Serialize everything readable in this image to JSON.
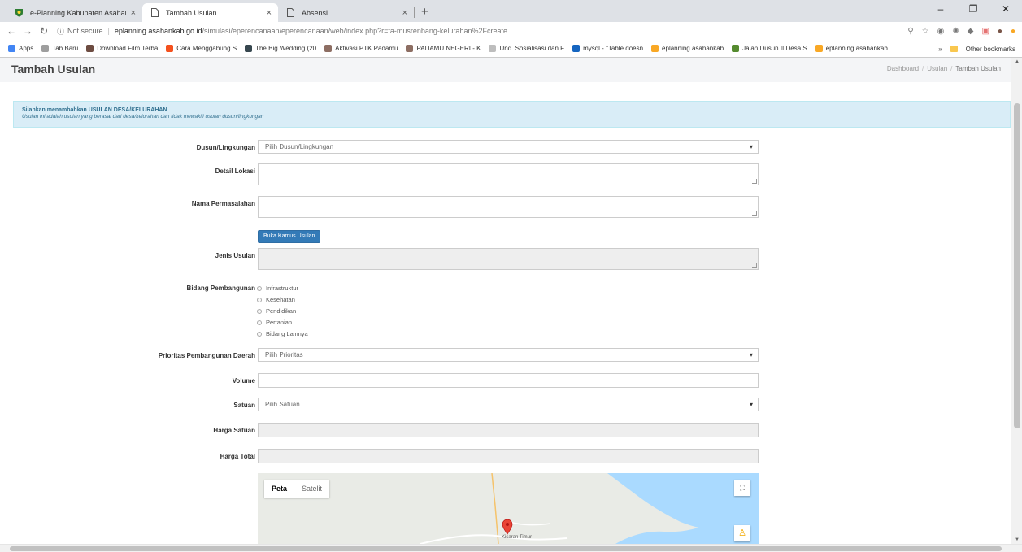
{
  "browser": {
    "tabs": [
      {
        "title": "e-Planning Kabupaten Asahan",
        "icon": "asahan-logo-icon",
        "active": false
      },
      {
        "title": "Tambah Usulan",
        "icon": "page-icon",
        "active": true
      },
      {
        "title": "Absensi",
        "icon": "page-icon",
        "active": false
      }
    ],
    "close_glyph": "×",
    "new_tab_glyph": "+",
    "address": {
      "security": "Not secure",
      "host": "eplanning.asahankab.go.id",
      "path": "/simulasi/eperencanaan/eperencanaan/web/index.php?r=ta-musrenbang-kelurahan%2Fcreate"
    },
    "bookmarks": [
      {
        "label": "Apps",
        "color": "#4285f4"
      },
      {
        "label": "Tab Baru",
        "color": "#9e9e9e"
      },
      {
        "label": "Download Film Terba",
        "color": "#6d4c41"
      },
      {
        "label": "Cara Menggabung S",
        "color": "#f4511e"
      },
      {
        "label": "The Big Wedding (20",
        "color": "#37474f"
      },
      {
        "label": "Aktivasi PTK Padamu",
        "color": "#8d6e63"
      },
      {
        "label": "PADAMU NEGERI - K",
        "color": "#8d6e63"
      },
      {
        "label": "Und. Sosialisasi dan F",
        "color": "#bdbdbd"
      },
      {
        "label": "mysql - \"Table doesn",
        "color": "#1565c0"
      },
      {
        "label": "eplanning.asahankab",
        "color": "#f9a825"
      },
      {
        "label": "Jalan Dusun II Desa S",
        "color": "#558b2f"
      },
      {
        "label": "eplanning.asahankab",
        "color": "#f9a825"
      }
    ],
    "bookmarks_more": "»",
    "other_bookmarks": "Other bookmarks"
  },
  "page": {
    "title": "Tambah Usulan",
    "breadcrumb": [
      "Dashboard",
      "Usulan",
      "Tambah Usulan"
    ],
    "alert": {
      "title": "Silahkan menambahkan USULAN DESA/KELURAHAN",
      "subtitle": "Usulan ini adalah usulan yang berasal dari desa/kelurahan dan tidak mewakili usulan dusun/lingkungan"
    },
    "form": {
      "dusun_label": "Dusun/Lingkungan",
      "dusun_value": "Pilih Dusun/Lingkungan",
      "detail_lokasi_label": "Detail Lokasi",
      "nama_permasalahan_label": "Nama Permasalahan",
      "kamus_button": "Buka Kamus Usulan",
      "jenis_usulan_label": "Jenis Usulan",
      "bidang_label": "Bidang Pembangunan",
      "bidang_options": [
        "Infrastruktur",
        "Kesehatan",
        "Pendidikan",
        "Pertanian",
        "Bidang Lainnya"
      ],
      "prioritas_label": "Prioritas Pembangunan Daerah",
      "prioritas_value": "Pilih Prioritas",
      "volume_label": "Volume",
      "satuan_label": "Satuan",
      "satuan_value": "Pilih Satuan",
      "harga_satuan_label": "Harga Satuan",
      "harga_total_label": "Harga Total"
    },
    "map": {
      "type_map": "Peta",
      "type_satellite": "Satelit",
      "place_label": "Kisaran Timur"
    }
  }
}
